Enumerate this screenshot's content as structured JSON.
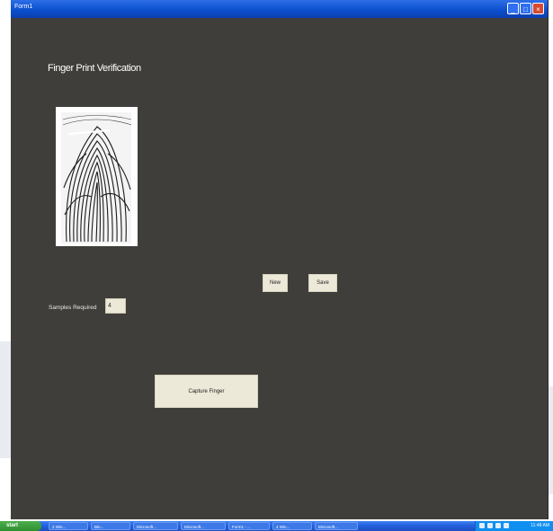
{
  "window": {
    "title": "Form1",
    "buttons": {
      "minimize": "_",
      "maximize": "□",
      "close": "×"
    }
  },
  "form": {
    "heading": "Finger Print Verification",
    "fingerprint_image": "fingerprint-image",
    "new_button": "New",
    "save_button": "Save",
    "samples_label": "Samples Required",
    "samples_value": "4",
    "scan_button": "Capture Finger"
  },
  "taskbar": {
    "start": "start",
    "items": [
      "2 Win...",
      "Bin...",
      "Microsoft...",
      "Microsoft...",
      "Form1 - ...",
      "4 Win...",
      "Microsoft..."
    ],
    "clock": "11:48 AM"
  },
  "colors": {
    "window_bg": "#3f3e3a",
    "titlebar": "#0a4ecd",
    "button_face": "#ece9d8",
    "taskbar": "#245edb",
    "start_button": "#2f8f2f"
  }
}
